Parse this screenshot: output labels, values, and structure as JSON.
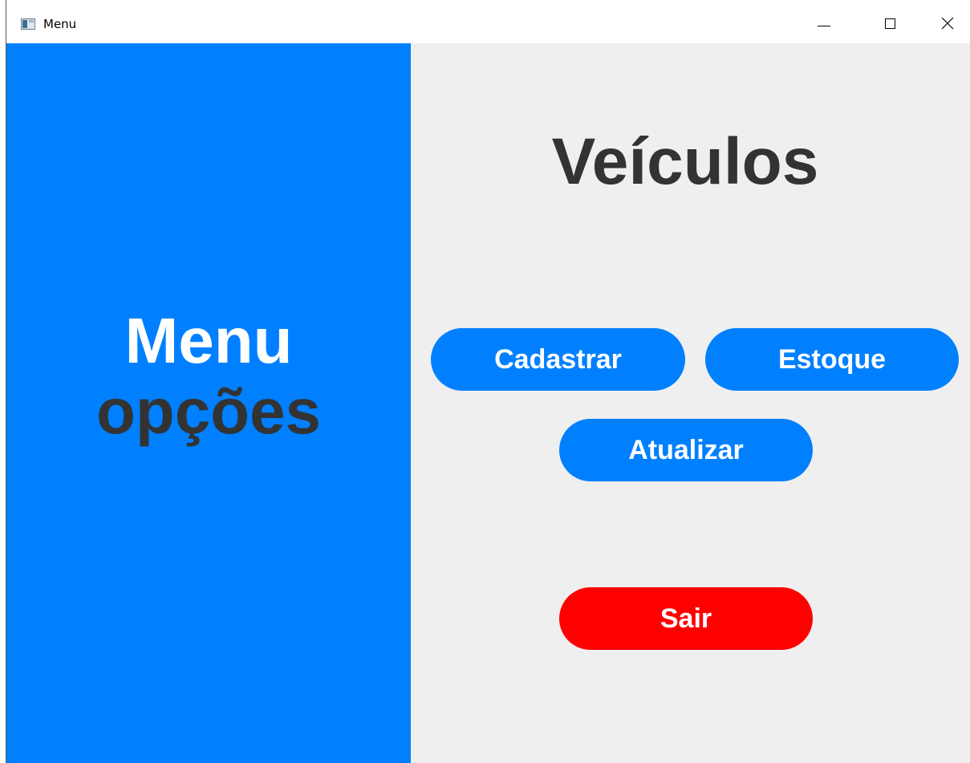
{
  "window": {
    "title": "Menu",
    "controls": {
      "minimize_icon": "minimize-icon",
      "maximize_icon": "maximize-icon",
      "close_icon": "close-icon"
    }
  },
  "sidebar": {
    "title": "Menu",
    "subtitle": "opções",
    "background_color": "#0080ff",
    "title_color": "#ffffff",
    "subtitle_color": "#333333"
  },
  "main": {
    "title": "Veículos",
    "background_color": "#efefef",
    "buttons": {
      "cadastrar": "Cadastrar",
      "estoque": "Estoque",
      "atualizar": "Atualizar",
      "sair": "Sair"
    },
    "button_color": "#0080ff",
    "exit_button_color": "#ff0000"
  }
}
